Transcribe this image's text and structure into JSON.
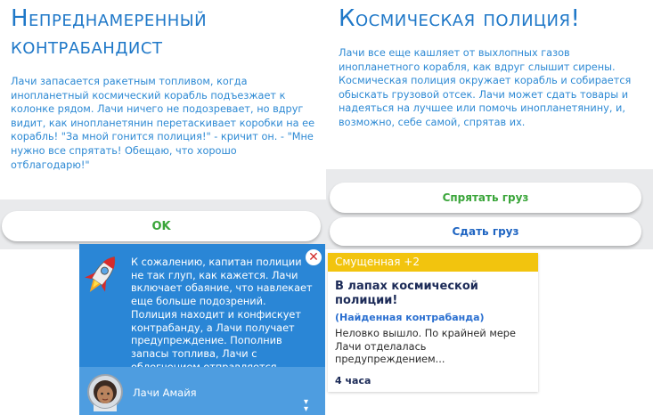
{
  "left_dialog": {
    "title": "Непреднамеренный контрабандист",
    "body": "Лачи запасается ракетным топливом, когда инопланетный космический корабль подъезжает к колонке рядом. Лачи ничего не подозревает, но вдруг видит, как инопланетянин перетаскивает коробки на ее корабль! \"За мной гонится полиция!\" - кричит он. - \"Мне нужно все спрятать! Обещаю, что хорошо отблагодарю!\"",
    "ok_label": "OK"
  },
  "right_dialog": {
    "title": "Космическая полиция!",
    "body": "Лачи все еще кашляет от выхлопных газов инопланетного корабля, как вдруг слышит сирены. Космическая полиция окружает корабль и собирается обыскать грузовой отсек. Лачи может сдать товары и надеяться на лучшее или помочь инопланетянину, и, возможно, себе самой, спрятав их.",
    "option_hide": "Спрятать груз",
    "option_give": "Сдать груз"
  },
  "notification": {
    "icon": "rocket-icon",
    "text": "К сожалению, капитан полиции не так глуп, как кажется. Лачи включает обаяние, что навлекает еще больше подозрений. Полиция находит и конфискует контрабанду, а Лачи получает предупреждение. Пополнив запасы топлива, Лачи с облегчением отправляется домой.",
    "sim_name": "Лачи Амайя"
  },
  "moodlet": {
    "header": "Смущенная +2",
    "title": "В лапах космической полиции!",
    "subtitle": "(Найденная контрабанда)",
    "description": "Неловко вышло. По крайней мере Лачи отделалась предупреждением...",
    "duration": "4 часа",
    "header_color": "#f2c40e"
  },
  "colors": {
    "title_blue": "#1f78c8",
    "notification_blue": "#2a86d6",
    "option_green": "#3aa53a",
    "option_blue": "#1f65c2"
  }
}
